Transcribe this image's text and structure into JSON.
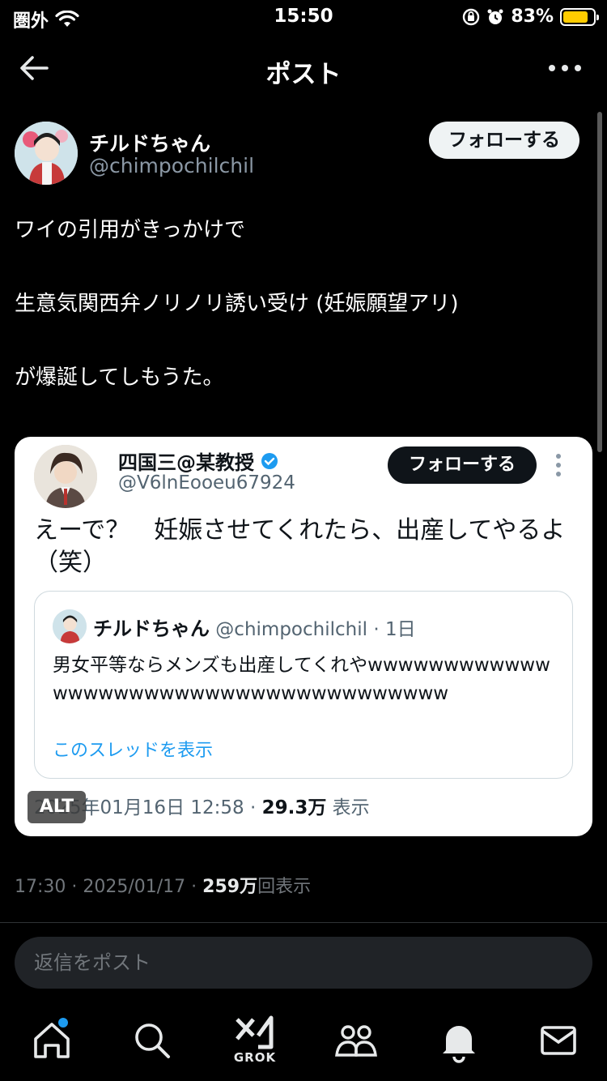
{
  "status_bar": {
    "carrier": "圏外",
    "time": "15:50",
    "battery_percent": "83%",
    "battery_level": 0.83,
    "battery_color": "#ffcc00"
  },
  "header": {
    "title": "ポスト"
  },
  "post": {
    "author_name": "チルドちゃん",
    "author_handle": "@chimpochilchil",
    "follow_label": "フォローする",
    "text_lines": [
      "ワイの引用がきっかけで",
      "生意気関西弁ノリノリ誘い受け (妊娠願望アリ)",
      "が爆誕してしもうた。"
    ],
    "timestamp": "17:30 · 2025/01/17 · ",
    "views_count": "259",
    "views_unit": "万",
    "views_label": "回表示"
  },
  "embedded_image": {
    "author_name": "四国三@某教授",
    "author_handle": "@V6lnEooeu67924",
    "follow_label": "フォローする",
    "text": "えーで？　妊娠させてくれたら、出産してやるよ（笑）",
    "quote": {
      "author_name": "チルドちゃん",
      "meta": " @chimpochilchil · 1日",
      "text": "男女平等ならメンズも出産してくれやwwwwwwwwwwwwwwwwwwwwwwwwwwwwwwwwwwwwww",
      "link": "このスレッドを表示"
    },
    "footer_date": "2025年01月16日 12:58 · ",
    "footer_views": "29.3万",
    "footer_views_label": " 表示",
    "alt_badge": "ALT"
  },
  "reply": {
    "placeholder": "返信をポスト"
  },
  "tab_bar": {
    "grok_label": "GROK",
    "icons": [
      "home-icon",
      "search-icon",
      "grok-icon",
      "communities-icon",
      "notifications-icon",
      "messages-icon"
    ]
  },
  "colors": {
    "background": "#000000",
    "accent": "#1d9bf0",
    "secondary_text": "#71767b"
  }
}
